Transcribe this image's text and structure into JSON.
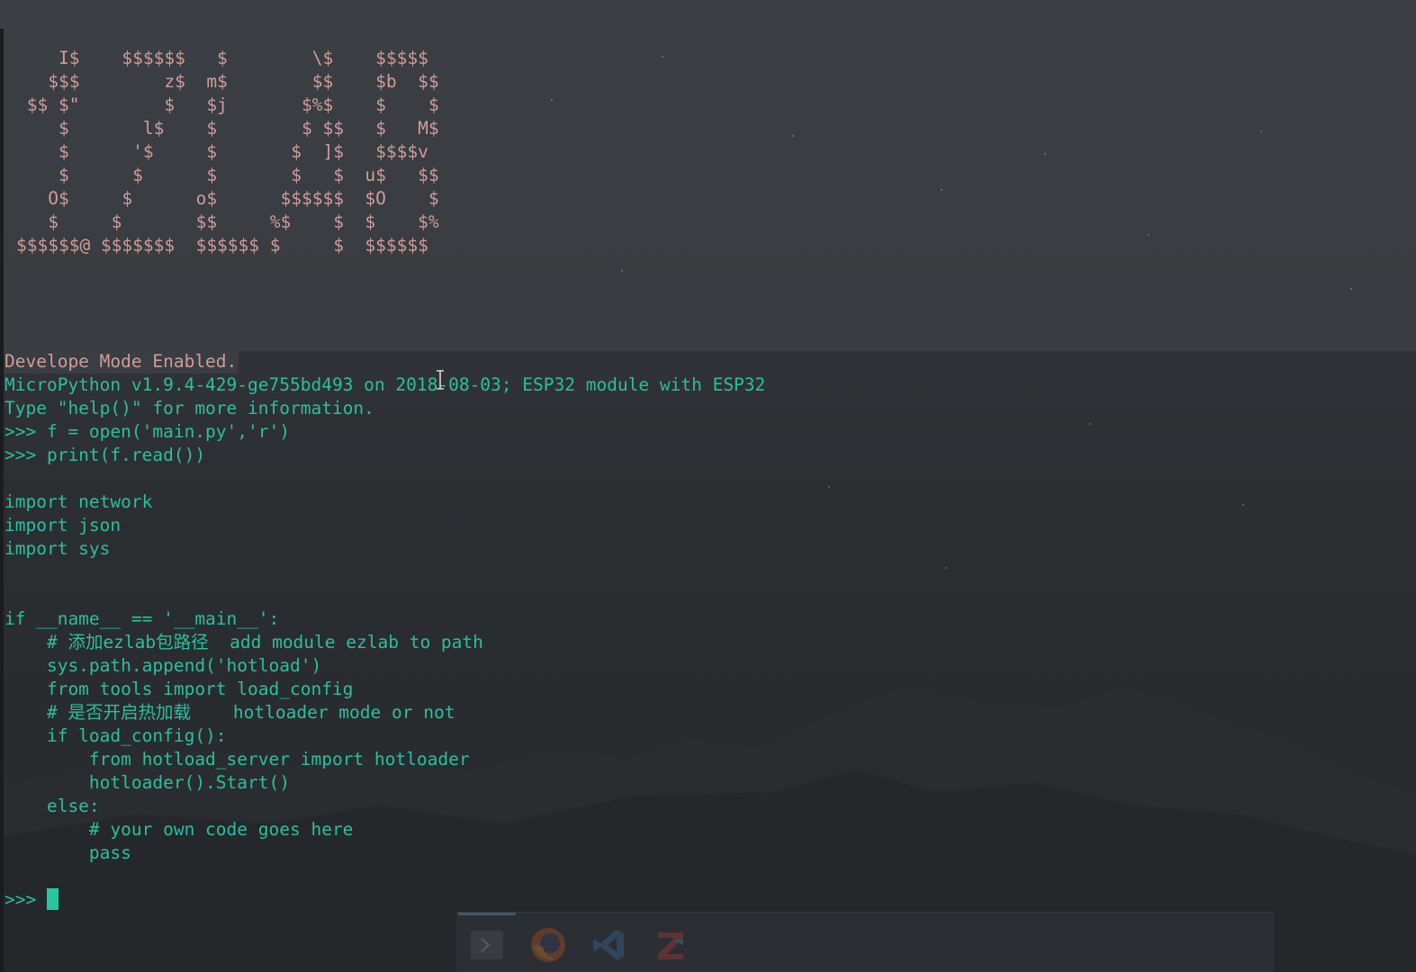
{
  "ascii_art": [
    "    I$    $$$$$$   $        \\$    $$$$$",
    "   $$$        z$  m$        $$    $b  $$",
    " $$ $\"        $   $j       $%$    $    $",
    "    $       l$    $        $ $$   $   M$",
    "    $      '$     $       $  ]$   $$$$v",
    "    $      $      $       $   $  u$   $$",
    "   O$     $      o$      $$$$$$  $O    $",
    "   $     $       $$     %$    $  $    $%",
    "$$$$$$@ $$$$$$$  $$$$$$ $     $  $$$$$$"
  ],
  "terminal": {
    "lines": [
      {
        "text": "Develope Mode Enabled.",
        "color": "pink"
      },
      {
        "text": "MicroPython v1.9.4-429-ge755bd493 on 2018-08-03; ESP32 module with ESP32",
        "color": "teal"
      },
      {
        "text": "Type \"help()\" for more information.",
        "color": "teal"
      },
      {
        "text": ">>> f = open('main.py','r')",
        "color": "teal"
      },
      {
        "text": ">>> print(f.read())",
        "color": "teal"
      },
      {
        "text": "",
        "color": "teal"
      },
      {
        "text": "import network",
        "color": "teal"
      },
      {
        "text": "import json",
        "color": "teal"
      },
      {
        "text": "import sys",
        "color": "teal"
      },
      {
        "text": "",
        "color": "teal"
      },
      {
        "text": "",
        "color": "teal"
      },
      {
        "text": "if __name__ == '__main__':",
        "color": "teal"
      },
      {
        "text": "    # 添加ezlab包路径  add module ezlab to path",
        "color": "teal"
      },
      {
        "text": "    sys.path.append('hotload')",
        "color": "teal"
      },
      {
        "text": "    from tools import load_config",
        "color": "teal"
      },
      {
        "text": "    # 是否开启热加载    hotloader mode or not",
        "color": "teal"
      },
      {
        "text": "    if load_config():",
        "color": "teal"
      },
      {
        "text": "        from hotload_server import hotloader",
        "color": "teal"
      },
      {
        "text": "        hotloader().Start()",
        "color": "teal"
      },
      {
        "text": "    else:",
        "color": "teal"
      },
      {
        "text": "        # your own code goes here",
        "color": "teal"
      },
      {
        "text": "        pass",
        "color": "teal"
      },
      {
        "text": "",
        "color": "teal"
      }
    ],
    "prompt": ">>> "
  },
  "colors": {
    "pink": "#cf9c9c",
    "teal": "#2bbfa0",
    "cursor": "#25c7a3"
  },
  "dock": {
    "items": [
      {
        "icon": "terminal-icon"
      },
      {
        "icon": "firefox-icon"
      },
      {
        "icon": "vscode-icon"
      },
      {
        "icon": "zeal-icon"
      }
    ]
  }
}
